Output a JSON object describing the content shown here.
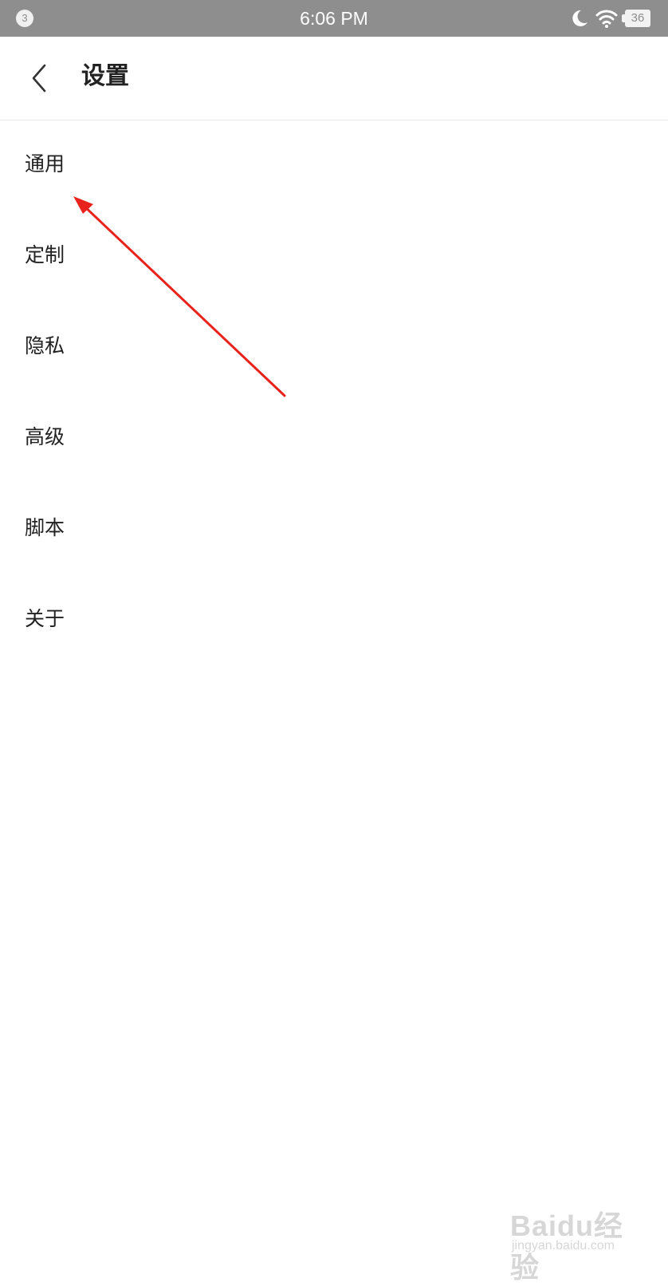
{
  "status_bar": {
    "notification_count": "3",
    "time": "6:06 PM",
    "battery": "36",
    "icons": [
      "moon-icon",
      "wifi-icon",
      "battery-icon"
    ]
  },
  "header": {
    "back_icon": "chevron-left-icon",
    "title": "设置"
  },
  "menu": {
    "items": [
      {
        "label": "通用"
      },
      {
        "label": "定制"
      },
      {
        "label": "隐私"
      },
      {
        "label": "高级"
      },
      {
        "label": "脚本"
      },
      {
        "label": "关于"
      }
    ]
  },
  "annotation": {
    "arrow_color": "#e8231c"
  },
  "watermark": {
    "main": "Baidu经验",
    "sub": "jingyan.baidu.com"
  },
  "colors": {
    "status_bar_bg": "#8e8e8e",
    "text": "#222222",
    "divider": "#e8e8e8"
  }
}
